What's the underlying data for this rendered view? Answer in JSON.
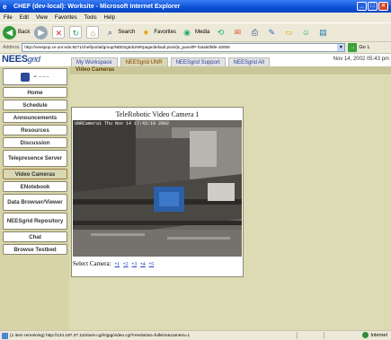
{
  "window": {
    "title": "CHEF (dev-local): Worksite - Microsoft Internet Explorer",
    "icon": "ie-icon"
  },
  "menu": [
    "File",
    "Edit",
    "View",
    "Favorites",
    "Tools",
    "Help"
  ],
  "toolbar": {
    "back_label": "Back",
    "search_label": "Search",
    "favorites_label": "Favorites",
    "media_label": "Media"
  },
  "address": {
    "label": "Address",
    "url": "http://neespop.ce.unr.edu:9271/chef/portal/group/NEESgridUNR/page/default.psml/js_panel/P-f16ab0f6fe-10006",
    "go_label": "Go",
    "links_label": "L"
  },
  "header": {
    "logo_text": "NEES",
    "logo_grid": "grid",
    "tabs": [
      "My Workspace",
      "NEESgrid UNR",
      "NEESgrid Support",
      "NEESgrid All"
    ],
    "active_tab": 1,
    "date": "Nov 14, 2002 05:43 pm"
  },
  "sidebar": {
    "items": [
      "Home",
      "Schedule",
      "Announcements",
      "Resources",
      "Discussion",
      "Telepresence Server",
      "Video Cameras",
      "ENotebook",
      "Data Browser/Viewer",
      "NEESgrid Repository",
      "Chat",
      "Browse Testbed"
    ],
    "active_index": 6
  },
  "content": {
    "heading": "Video Cameras",
    "camera_title": "TeleRobotic Video Camera 1",
    "camera_stamp": "UNRCamera1  Thu Nov 14  17:43:19  2002",
    "select_label": "Select Camera:",
    "camera_links": [
      "1",
      "2",
      "3",
      "4",
      "5"
    ]
  },
  "status": {
    "text": "(1 item remaining) http://134.197.37.110/axis-cgi/mjpg/video.cgi?resolution=fullsize&camera=1",
    "zone": "Internet"
  }
}
